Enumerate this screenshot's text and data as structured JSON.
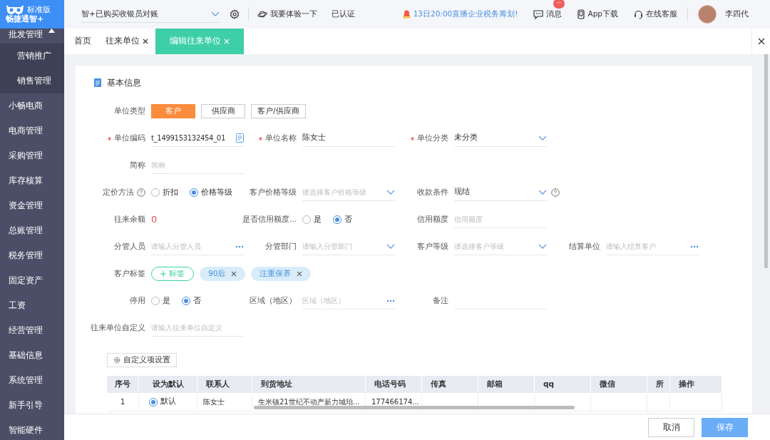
{
  "logo": {
    "edition": "标准版",
    "name": "畅捷通智+"
  },
  "sidebar": {
    "items": [
      {
        "label": "批发管理",
        "expanded": true,
        "children": [
          {
            "label": "营销推广"
          },
          {
            "label": "销售管理"
          }
        ]
      },
      {
        "label": "小畅电商"
      },
      {
        "label": "电商管理"
      },
      {
        "label": "采购管理"
      },
      {
        "label": "库存核算"
      },
      {
        "label": "资金管理"
      },
      {
        "label": "总账管理"
      },
      {
        "label": "税务管理"
      },
      {
        "label": "固定资产"
      },
      {
        "label": "工资"
      },
      {
        "label": "经营管理"
      },
      {
        "label": "基础信息"
      },
      {
        "label": "系统管理"
      },
      {
        "label": "新手引导"
      },
      {
        "label": "智能硬件"
      }
    ]
  },
  "topbar": {
    "account_select": "智+已购买收银员对账",
    "experience": "我要体验一下",
    "verified": "已认证",
    "notice": "13日20:00直播企业税务筹划!",
    "tools": [
      {
        "kind": "message",
        "label": "消息",
        "badge": "···"
      },
      {
        "kind": "app",
        "label": "App下载"
      },
      {
        "kind": "service",
        "label": "在线客服"
      }
    ],
    "user": "李四代"
  },
  "tabs": [
    {
      "label": "首页",
      "closable": false,
      "selected": false
    },
    {
      "label": "往来单位",
      "closable": true,
      "selected": false
    },
    {
      "label": "编辑往来单位",
      "closable": true,
      "selected": true
    }
  ],
  "section_title": "基本信息",
  "form_rows": [
    [
      {
        "kind": "choice",
        "label": "单位类型",
        "options": [
          {
            "label": "客户",
            "selected": true
          },
          {
            "label": "供应商",
            "selected": false
          },
          {
            "label": "客户/供应商",
            "selected": false
          }
        ]
      }
    ],
    [
      {
        "kind": "code",
        "label": "单位编码",
        "required": true,
        "value": "t_1499153132454_01"
      },
      {
        "kind": "input",
        "label": "单位名称",
        "required": true,
        "value": "陈女士"
      },
      {
        "kind": "select",
        "label": "单位分类",
        "required": true,
        "value": "未分类"
      }
    ],
    [
      {
        "kind": "input",
        "label": "简称",
        "placeholder": "简称"
      }
    ],
    [
      {
        "kind": "radio",
        "label": "定价方法",
        "help": true,
        "options": [
          {
            "label": "折扣",
            "selected": false
          },
          {
            "label": "价格等级",
            "selected": true
          }
        ]
      },
      {
        "kind": "select",
        "label": "客户价格等级",
        "placeholder": "请选择客户价格等级"
      },
      {
        "kind": "select",
        "label": "收款条件",
        "help": true,
        "value": "现结"
      }
    ],
    [
      {
        "kind": "amount",
        "label": "往来余额",
        "value": "0"
      },
      {
        "kind": "radio",
        "label": "是否信用额度...",
        "options": [
          {
            "label": "是",
            "selected": false
          },
          {
            "label": "否",
            "selected": true
          }
        ]
      },
      {
        "kind": "input",
        "label": "信用额度",
        "placeholder": "信用额度"
      }
    ],
    [
      {
        "kind": "picker",
        "label": "分管人员",
        "placeholder": "请输入分管人员"
      },
      {
        "kind": "select",
        "label": "分管部门",
        "placeholder": "请输入分管部门"
      },
      {
        "kind": "select",
        "label": "客户等级",
        "placeholder": "请选择客户等级"
      },
      {
        "kind": "picker",
        "label": "结算单位",
        "placeholder": "请输入结算客户"
      }
    ],
    [
      {
        "kind": "tags",
        "label": "客户标签",
        "add": "标签",
        "tags": [
          "90后",
          "注重保养"
        ]
      }
    ],
    [
      {
        "kind": "radio",
        "label": "停用",
        "options": [
          {
            "label": "是",
            "selected": false
          },
          {
            "label": "否",
            "selected": true
          }
        ]
      },
      {
        "kind": "picker",
        "label": "区域（地区）",
        "placeholder": "区域（地区）"
      },
      {
        "kind": "input",
        "label": "备注"
      }
    ],
    [
      {
        "kind": "input",
        "label": "往来单位自定义",
        "placeholder": "请输入往来单位自定义"
      }
    ]
  ],
  "custom_button": "自定义项设置",
  "table": {
    "columns": [
      "序号",
      "设为默认",
      "联系人",
      "到货地址",
      "电话号码",
      "传真",
      "邮箱",
      "qq",
      "微信",
      "所",
      "操作"
    ],
    "rows": [
      {
        "default_selected": true,
        "cells": [
          "1",
          "默认",
          "陈女士",
          "生米镇21世纪不动产新力城珀...",
          "177466174..."
        ]
      }
    ]
  },
  "footer_buttons": [
    {
      "kind": "cancel",
      "label": "取消"
    },
    {
      "kind": "save",
      "label": "保存"
    }
  ]
}
